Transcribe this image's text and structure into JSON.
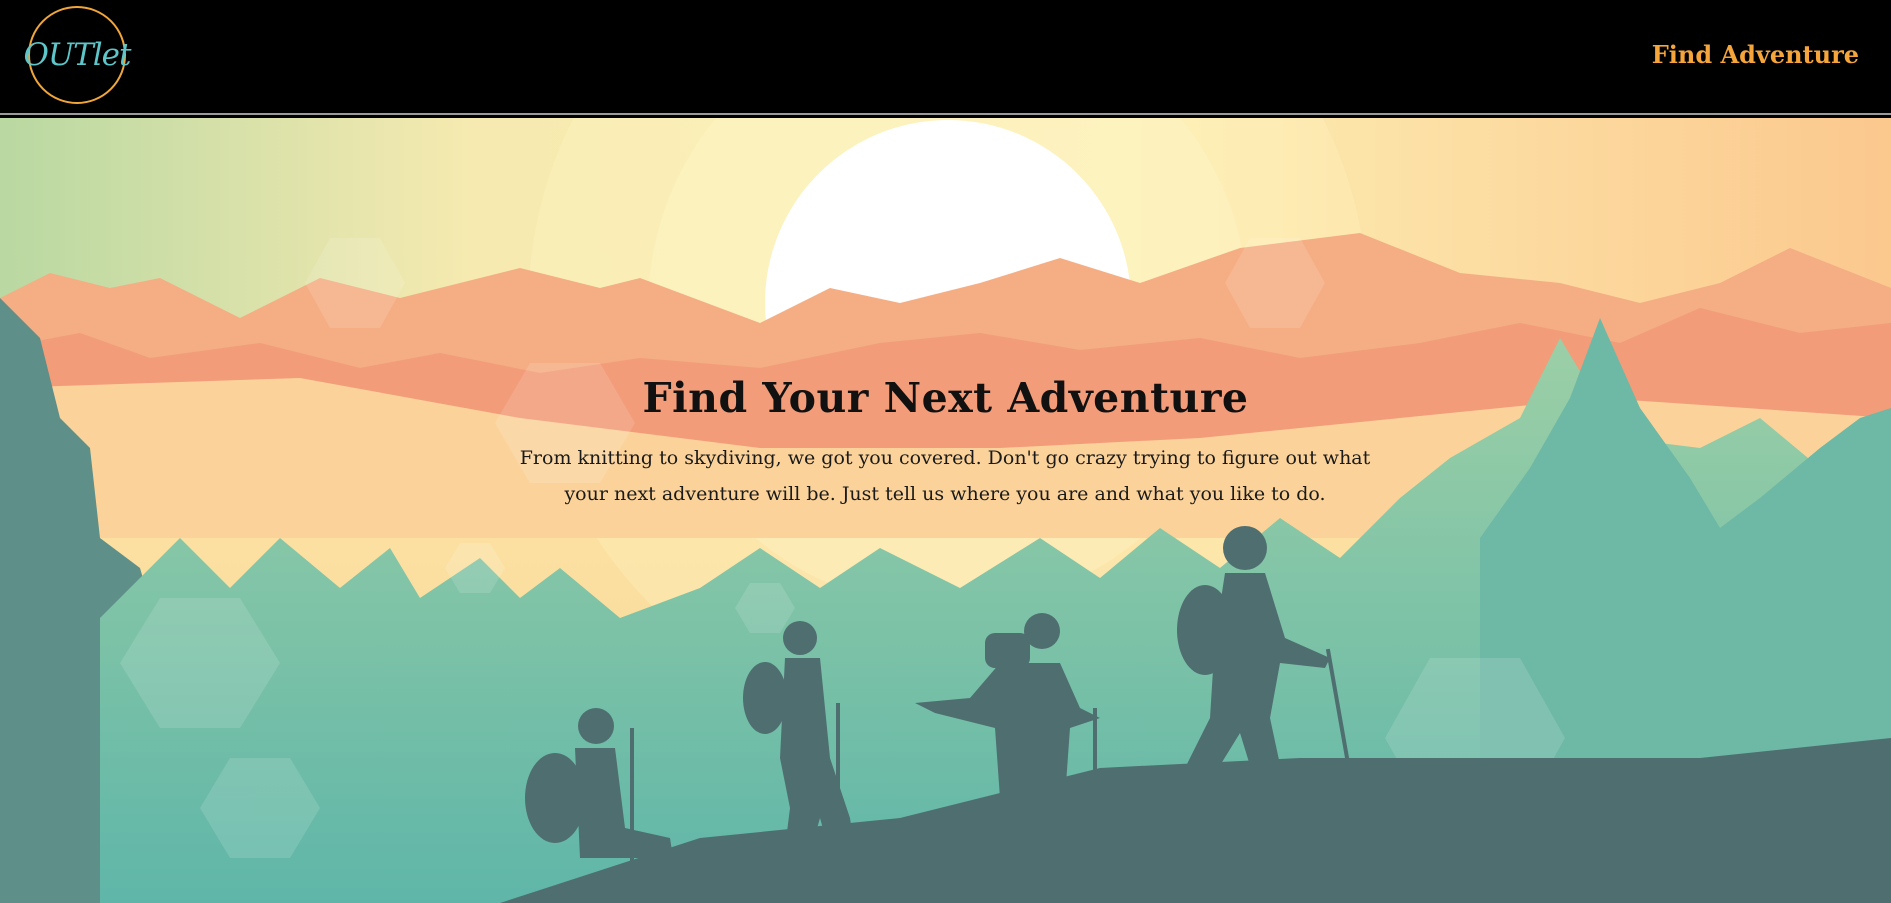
{
  "navbar": {
    "logo_text": "OUTlet",
    "nav_link_label": "Find Adventure"
  },
  "hero": {
    "title": "Find Your Next Adventure",
    "description": "From knitting to skydiving, we got you covered. Don't go crazy trying to figure out what your next adventure will be. Just tell us where you are and what you like to do."
  },
  "colors": {
    "logo_ring": "#f0a63a",
    "logo_text": "#5ec6c9",
    "nav_link": "#f5a53a",
    "sky_top": "#fbeeb0",
    "mountain": "#f2a07a",
    "forest": "#5fb6a8",
    "silhouette": "#4f6e70"
  }
}
